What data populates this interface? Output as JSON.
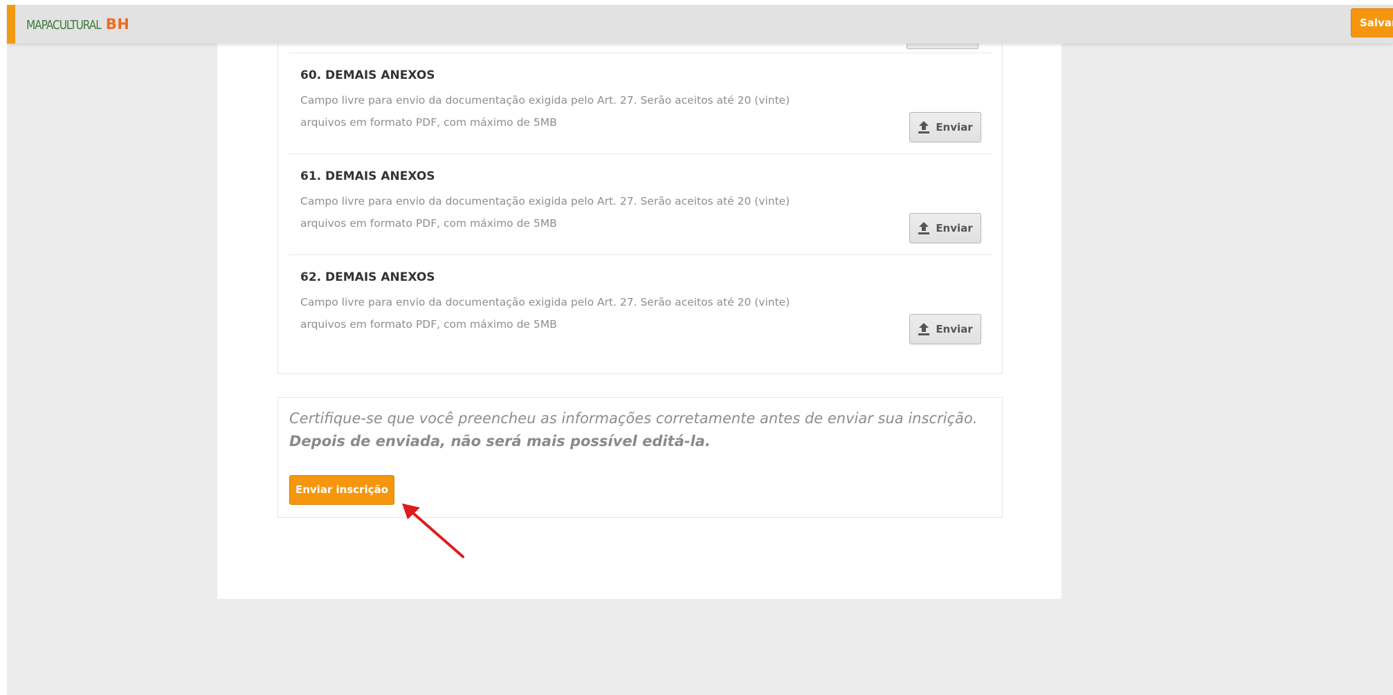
{
  "header": {
    "logo_prefix": "MAPACULTURAL",
    "logo_suffix": "BH",
    "save_label": "Salvar"
  },
  "attachments": [
    {
      "title": "60. DEMAIS ANEXOS",
      "desc_line1": "Campo livre para envio da documentação exigida pelo Art. 27. Serão aceitos até 20 (vinte)",
      "desc_line2": "arquivos em formato PDF, com máximo de 5MB",
      "button_label": "Enviar"
    },
    {
      "title": "61. DEMAIS ANEXOS",
      "desc_line1": "Campo livre para envio da documentação exigida pelo Art. 27. Serão aceitos até 20 (vinte)",
      "desc_line2": "arquivos em formato PDF, com máximo de 5MB",
      "button_label": "Enviar"
    },
    {
      "title": "62. DEMAIS ANEXOS",
      "desc_line1": "Campo livre para envio da documentação exigida pelo Art. 27. Serão aceitos até 20 (vinte)",
      "desc_line2": "arquivos em formato PDF, com máximo de 5MB",
      "button_label": "Enviar"
    }
  ],
  "confirm": {
    "text_normal": "Certifique-se que você preencheu as informações corretamente antes de enviar sua inscrição. ",
    "text_strong": "Depois de enviada, não será mais possível editá-la.",
    "submit_label": "Enviar inscrição"
  },
  "colors": {
    "accent": "#f5960e",
    "logo_green": "#3e7b3b",
    "logo_orange": "#f26b1c",
    "annotation_red": "#e01b1b"
  },
  "icons": {
    "upload": "upload-icon",
    "annotation": "red-arrow-annotation"
  }
}
